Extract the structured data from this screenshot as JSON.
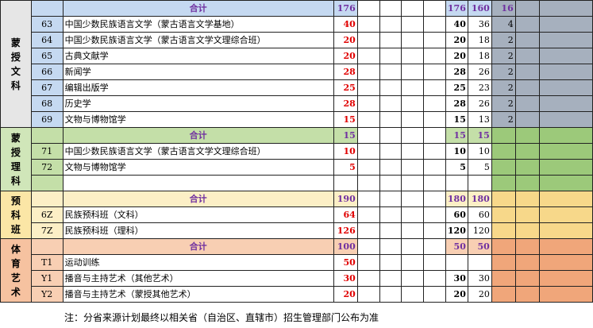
{
  "groups": [
    {
      "label": "蒙授文科",
      "total_label": "合计",
      "total": {
        "c1": "176",
        "c6": "176",
        "c7": "160",
        "c8": "16"
      },
      "rows": [
        {
          "code": "63",
          "name": "中国少数民族语言文学（蒙古语言文学基地）",
          "c1": "40",
          "c6": "40",
          "c7": "36",
          "c8": "4"
        },
        {
          "code": "64",
          "name": "中国少数民族语言文学（蒙古语言文学文理综合班）",
          "c1": "20",
          "c6": "20",
          "c7": "18",
          "c8": "2"
        },
        {
          "code": "65",
          "name": "古典文献学",
          "c1": "20",
          "c6": "20",
          "c7": "18",
          "c8": "2"
        },
        {
          "code": "66",
          "name": "新闻学",
          "c1": "28",
          "c6": "28",
          "c7": "26",
          "c8": "2"
        },
        {
          "code": "67",
          "name": "编辑出版学",
          "c1": "25",
          "c6": "25",
          "c7": "23",
          "c8": "2"
        },
        {
          "code": "68",
          "name": "历史学",
          "c1": "28",
          "c6": "28",
          "c7": "26",
          "c8": "2"
        },
        {
          "code": "69",
          "name": "文物与博物馆学",
          "c1": "15",
          "c6": "15",
          "c7": "13",
          "c8": "2"
        }
      ]
    },
    {
      "label": "蒙授理科",
      "total_label": "合计",
      "total": {
        "c1": "15",
        "c6": "15",
        "c7": "15",
        "c8": ""
      },
      "rows": [
        {
          "code": "71",
          "name": "中国少数民族语言文学（蒙古语言文学文理综合班）",
          "c1": "10",
          "c6": "10",
          "c7": "10",
          "c8": ""
        },
        {
          "code": "72",
          "name": "文物与博物馆学",
          "c1": "5",
          "c6": "5",
          "c7": "5",
          "c8": ""
        },
        {
          "code": "",
          "name": "",
          "c1": "",
          "c6": "",
          "c7": "",
          "c8": ""
        }
      ]
    },
    {
      "label": "预科班",
      "total_label": "合计",
      "total": {
        "c1": "190",
        "c6": "180",
        "c7": "180",
        "c8": ""
      },
      "rows": [
        {
          "code": "6Z",
          "name": "民族预科班（文科）",
          "c1": "64",
          "c6": "60",
          "c7": "60",
          "c8": ""
        },
        {
          "code": "7Z",
          "name": "民族预科班（理科）",
          "c1": "126",
          "c6": "120",
          "c7": "120",
          "c8": ""
        }
      ]
    },
    {
      "label": "体育艺术",
      "total_label": "合计",
      "total": {
        "c1": "100",
        "c6": "50",
        "c7": "50",
        "c8": ""
      },
      "rows": [
        {
          "code": "T1",
          "name": "运动训练",
          "c1": "50",
          "c6": "",
          "c7": "",
          "c8": ""
        },
        {
          "code": "Y1",
          "name": "播音与主持艺术（其他艺术）",
          "c1": "30",
          "c6": "30",
          "c7": "30",
          "c8": ""
        },
        {
          "code": "Y2",
          "name": "播音与主持艺术（蒙授其他艺术）",
          "c1": "20",
          "c6": "20",
          "c7": "20",
          "c8": ""
        }
      ]
    }
  ],
  "note": "注：分省来源计划最终以相关省（自治区、直辖市）招生管理部门公布为准"
}
